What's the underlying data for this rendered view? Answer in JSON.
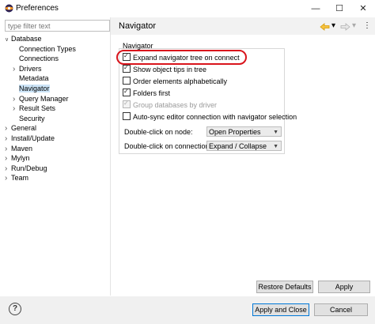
{
  "window": {
    "title": "Preferences",
    "minimize_glyph": "—",
    "maximize_glyph": "☐",
    "close_glyph": "✕"
  },
  "filter": {
    "placeholder": "type filter text",
    "value": ""
  },
  "tree": [
    {
      "label": "Database",
      "level": 0,
      "expanded": true
    },
    {
      "label": "Connection Types",
      "level": 1
    },
    {
      "label": "Connections",
      "level": 1
    },
    {
      "label": "Drivers",
      "level": 1,
      "collapsed": true
    },
    {
      "label": "Metadata",
      "level": 1
    },
    {
      "label": "Navigator",
      "level": 1,
      "selected": true
    },
    {
      "label": "Query Manager",
      "level": 1,
      "collapsed": true
    },
    {
      "label": "Result Sets",
      "level": 1,
      "collapsed": true
    },
    {
      "label": "Security",
      "level": 1
    },
    {
      "label": "General",
      "level": 0,
      "collapsed": true
    },
    {
      "label": "Install/Update",
      "level": 0,
      "collapsed": true
    },
    {
      "label": "Maven",
      "level": 0,
      "collapsed": true
    },
    {
      "label": "Mylyn",
      "level": 0,
      "collapsed": true
    },
    {
      "label": "Run/Debug",
      "level": 0,
      "collapsed": true
    },
    {
      "label": "Team",
      "level": 0,
      "collapsed": true
    }
  ],
  "page": {
    "title": "Navigator",
    "group_label": "Navigator"
  },
  "options": [
    {
      "label": "Expand navigator tree on connect",
      "checked": true,
      "enabled": true
    },
    {
      "label": "Show object tips in tree",
      "checked": true,
      "enabled": true
    },
    {
      "label": "Order elements alphabetically",
      "checked": false,
      "enabled": true
    },
    {
      "label": "Folders first",
      "checked": true,
      "enabled": true
    },
    {
      "label": "Group databases by driver",
      "checked": true,
      "enabled": false
    },
    {
      "label": "Auto-sync editor connection with navigator selection",
      "checked": false,
      "enabled": true
    }
  ],
  "settings": {
    "dblclick_node_label": "Double-click on node:",
    "dblclick_node_value": "Open Properties",
    "dblclick_conn_label": "Double-click on connection:",
    "dblclick_conn_value": "Expand / Collapse"
  },
  "buttons": {
    "restore_defaults": "Restore Defaults",
    "apply": "Apply",
    "apply_and_close": "Apply and Close",
    "cancel": "Cancel",
    "help_glyph": "?"
  },
  "colors": {
    "highlight": "#d9141c",
    "selection": "#cce4f7",
    "nav_arrow": "#e0a000"
  }
}
